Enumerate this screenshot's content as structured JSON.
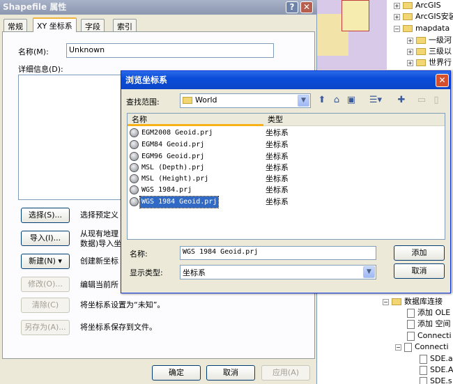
{
  "props_dialog": {
    "title": "Shapefile 属性",
    "help_glyph": "?",
    "close_glyph": "✕",
    "tabs": [
      {
        "label": "常规"
      },
      {
        "label": "XY 坐标系"
      },
      {
        "label": "字段"
      },
      {
        "label": "索引"
      }
    ],
    "name_label": "名称(M):",
    "name_value": "Unknown",
    "details_label": "详细信息(D):",
    "buttons": [
      {
        "label": "选择(S)...",
        "desc_lines": [
          "选择预定义"
        ]
      },
      {
        "label": "导入(I)...",
        "desc_lines": [
          "从现有地理",
          "数据)导入坐"
        ]
      },
      {
        "label": "新建(N) ▾",
        "desc_lines": [
          "创建新坐标"
        ]
      },
      {
        "label": "修改(O)...",
        "desc_lines": [
          "编辑当前所"
        ]
      },
      {
        "label": "清除(C)",
        "desc_lines": [
          "将坐标系设置为“未知”。"
        ]
      },
      {
        "label": "另存为(A)...",
        "desc_lines": [
          "将坐标系保存到文件。"
        ]
      }
    ],
    "ok_label": "确定",
    "cancel_label": "取消",
    "apply_label": "应用(A)"
  },
  "catalog_tree": {
    "top_items": [
      {
        "label": "ArcGIS",
        "expander": "+",
        "icon": "folder-icon"
      },
      {
        "label": "ArcGIS安装",
        "expander": "+",
        "icon": "folder-icon"
      },
      {
        "label": "mapdata",
        "expander": "−",
        "icon": "folder-icon"
      },
      {
        "label": "一级河",
        "expander": "+",
        "icon": "folder-icon"
      },
      {
        "label": "三级以",
        "expander": "+",
        "icon": "folder-icon"
      },
      {
        "label": "世界行",
        "expander": "+",
        "icon": "folder-icon"
      }
    ],
    "bottom_items": [
      {
        "label": "数据库连接",
        "expander": "−",
        "icon": "database-connections-icon"
      },
      {
        "label": "添加 OLE",
        "expander": "",
        "icon": "add-ole-icon"
      },
      {
        "label": "添加 空间",
        "expander": "",
        "icon": "add-spatial-icon"
      },
      {
        "label": "Connecti",
        "expander": "",
        "icon": "connection-icon"
      },
      {
        "label": "Connecti",
        "expander": "−",
        "icon": "connection-icon"
      },
      {
        "label": "SDE.a",
        "expander": "",
        "icon": "sde-icon"
      },
      {
        "label": "SDE.A",
        "expander": "",
        "icon": "sde-icon"
      },
      {
        "label": "SDE.s",
        "expander": "",
        "icon": "sde-icon"
      }
    ]
  },
  "browse_dialog": {
    "title": "浏览坐标系",
    "close_glyph": "✕",
    "lookin_label": "查找范围:",
    "lookin_value": "World",
    "columns": {
      "name": "名称",
      "type": "类型"
    },
    "files": [
      {
        "name": "EGM2008 Geoid.prj",
        "type": "坐标系"
      },
      {
        "name": "EGM84 Geoid.prj",
        "type": "坐标系"
      },
      {
        "name": "EGM96 Geoid.prj",
        "type": "坐标系"
      },
      {
        "name": "MSL (Depth).prj",
        "type": "坐标系"
      },
      {
        "name": "MSL (Height).prj",
        "type": "坐标系"
      },
      {
        "name": "WGS 1984.prj",
        "type": "坐标系"
      },
      {
        "name": "WGS 1984 Geoid.prj",
        "type": "坐标系",
        "selected": true
      }
    ],
    "filename_label": "名称:",
    "filename_value": "WGS 1984 Geoid.prj",
    "filetype_label": "显示类型:",
    "filetype_value": "坐标系",
    "add_label": "添加",
    "cancel_label": "取消"
  }
}
